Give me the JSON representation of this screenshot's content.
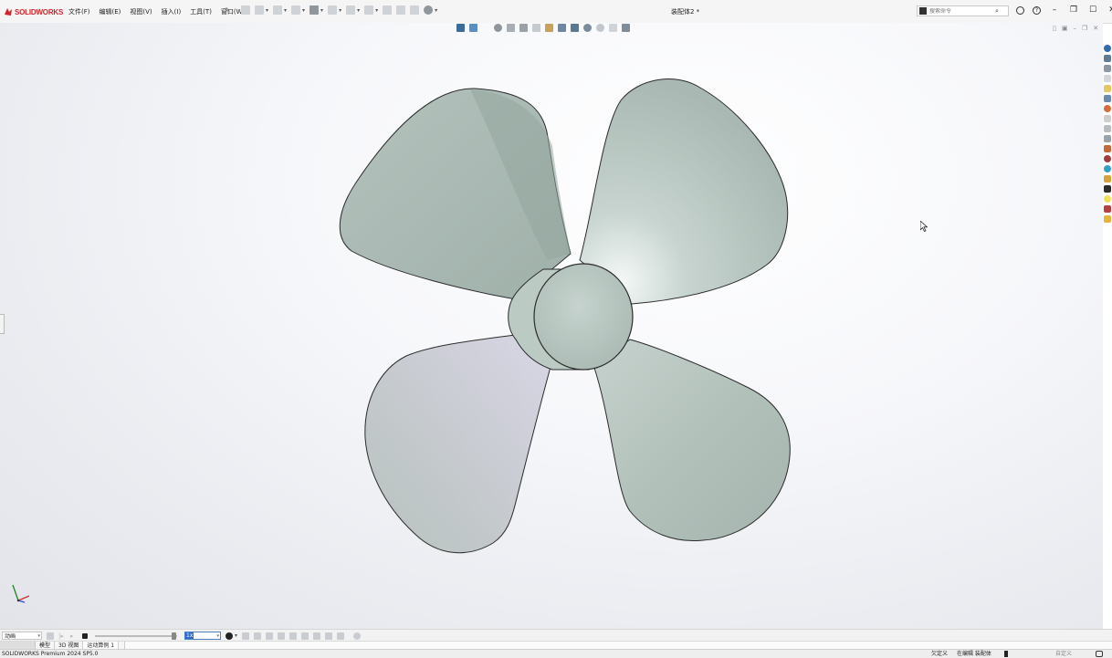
{
  "app": {
    "brand": "SOLIDWORKS",
    "document_title": "装配体2 *"
  },
  "menu": [
    "文件(F)",
    "编辑(E)",
    "视图(V)",
    "插入(I)",
    "工具(T)",
    "窗口(W)"
  ],
  "search": {
    "placeholder": "搜索命令"
  },
  "motion": {
    "study_type": "动画",
    "speed": "1x"
  },
  "tabs": [
    {
      "label": "模型",
      "active": false
    },
    {
      "label": "3D 视图",
      "active": false
    },
    {
      "label": "运动算例 1",
      "active": true
    }
  ],
  "status": {
    "product": "SOLIDWORKS Premium 2024 SP5.0",
    "definition": "欠定义",
    "editing": "在编辑 装配体",
    "customize": "自定义"
  },
  "colors": {
    "brand_red": "#d2232a",
    "blade": "#a9b8b2",
    "blade_light": "#d8e2de",
    "hub": "#b7c6c0",
    "edge": "#2b2b2b",
    "selection": "#2f6bd0"
  }
}
